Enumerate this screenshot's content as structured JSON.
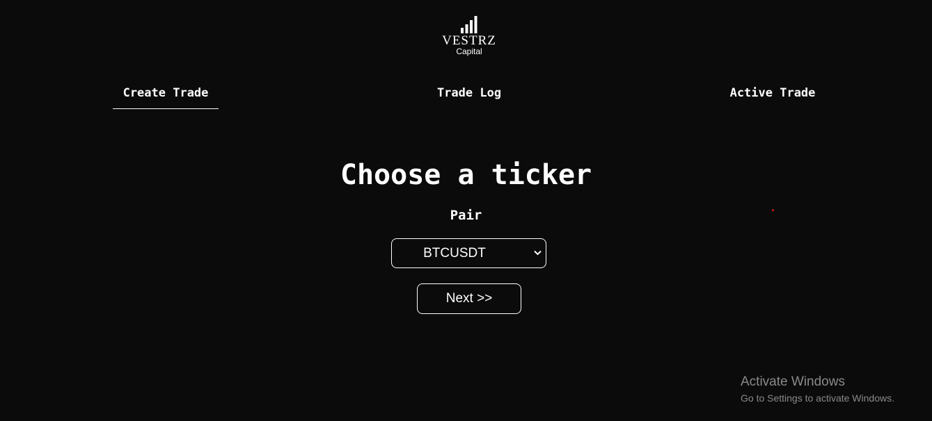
{
  "brand": {
    "name": "VESTRZ",
    "sub": "Capital",
    "logo_icon": "signal-bars-icon"
  },
  "nav": {
    "tabs": [
      {
        "label": "Create Trade",
        "active": true
      },
      {
        "label": "Trade Log",
        "active": false
      },
      {
        "label": "Active Trade",
        "active": false
      }
    ]
  },
  "main": {
    "heading": "Choose a ticker",
    "pair_label": "Pair",
    "pair_select": {
      "value": "BTCUSDT",
      "icon": "chevron-down-icon"
    },
    "next_label": "Next >>"
  },
  "watermark": {
    "title": "Activate Windows",
    "subtitle": "Go to Settings to activate Windows."
  },
  "colors": {
    "background": "#0b0b0b",
    "text": "#ffffff",
    "watermark": "#8a8a8a",
    "dot": "#d11a1a"
  }
}
